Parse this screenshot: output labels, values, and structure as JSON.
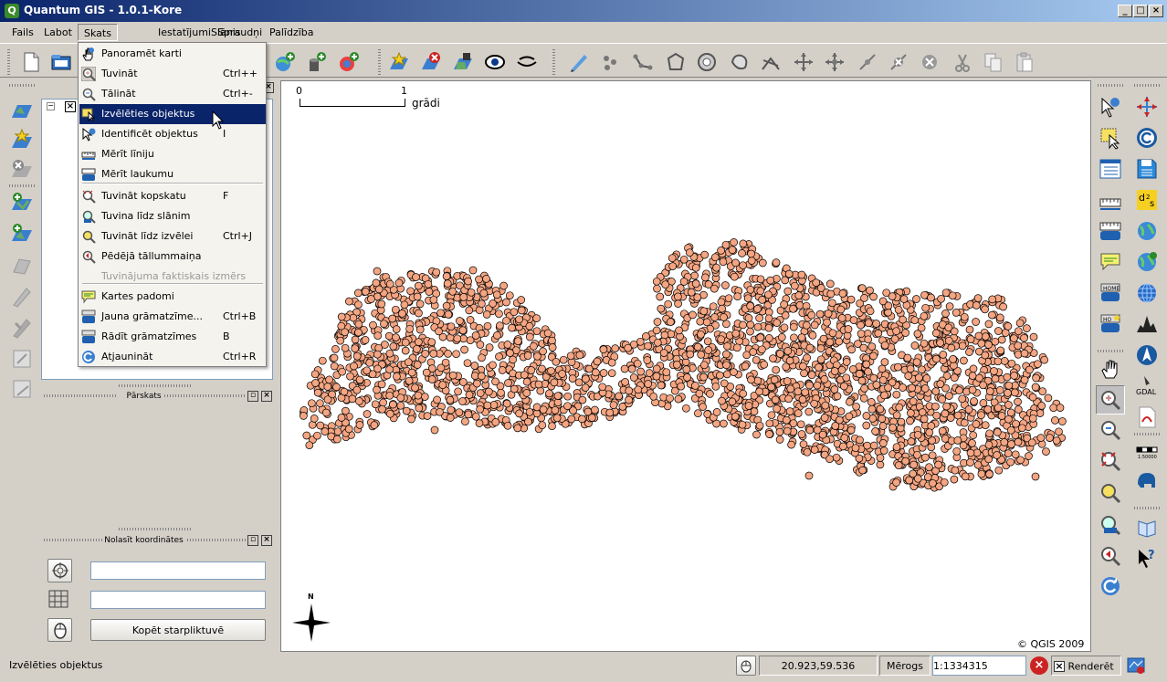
{
  "window": {
    "title": "Quantum GIS - 1.0.1-Kore",
    "app_icon": "Q"
  },
  "menubar": [
    "Fails",
    "Labot",
    "Skats",
    "Iestatījumi",
    "Slānis",
    "Spraudņi",
    "Palīdzība"
  ],
  "view_menu": {
    "items": [
      {
        "label": "Panoramēt karti",
        "shortcut": "",
        "icon": "pan-hand-icon"
      },
      {
        "label": "Tuvināt",
        "shortcut": "Ctrl++",
        "icon": "zoom-in-icon"
      },
      {
        "label": "Tālināt",
        "shortcut": "Ctrl+-",
        "icon": "zoom-out-icon"
      },
      {
        "label": "Izvēlēties objektus",
        "shortcut": "",
        "icon": "select-features-icon"
      },
      {
        "label": "Identificēt objektus",
        "shortcut": "I",
        "icon": "identify-icon"
      },
      {
        "label": "Mērīt līniju",
        "shortcut": "",
        "icon": "measure-line-icon"
      },
      {
        "label": "Mērīt laukumu",
        "shortcut": "",
        "icon": "measure-area-icon"
      },
      {
        "label": "Tuvināt kopskatu",
        "shortcut": "F",
        "icon": "zoom-full-icon"
      },
      {
        "label": "Tuvina līdz slānim",
        "shortcut": "",
        "icon": "zoom-layer-icon"
      },
      {
        "label": "Tuvināt līdz izvēlei",
        "shortcut": "Ctrl+J",
        "icon": "zoom-selection-icon"
      },
      {
        "label": "Pēdējā tāllummaiņa",
        "shortcut": "",
        "icon": "zoom-last-icon"
      },
      {
        "label": "Tuvinājuma faktiskais izmērs",
        "shortcut": "",
        "icon": ""
      },
      {
        "label": "Kartes padomi",
        "shortcut": "",
        "icon": "map-tips-icon"
      },
      {
        "label": "Jauna grāmatzīme...",
        "shortcut": "Ctrl+B",
        "icon": "new-bookmark-icon"
      },
      {
        "label": "Rādīt grāmatzīmes",
        "shortcut": "B",
        "icon": "show-bookmarks-icon"
      },
      {
        "label": "Atjaunināt",
        "shortcut": "Ctrl+R",
        "icon": "refresh-icon"
      }
    ]
  },
  "map": {
    "scalebar": {
      "left": "0",
      "right": "1",
      "unit": "grādi"
    },
    "north_arrow": "N",
    "copyright": "© QGIS 2009",
    "point_fill": "#f4a582",
    "point_stroke": "#000000"
  },
  "overview_panel": {
    "title": "Pārskats"
  },
  "coordinate_panel": {
    "title": "Nolasīt koordinātes",
    "copy_button": "Kopēt starpliktuvē",
    "field1": "",
    "field2": ""
  },
  "statusbar": {
    "message": "Izvēlēties objektus",
    "coords": "20.923,59.536",
    "scale_label": "Mērogs",
    "scale_value": "1:1334315",
    "render_label": "Renderēt"
  }
}
